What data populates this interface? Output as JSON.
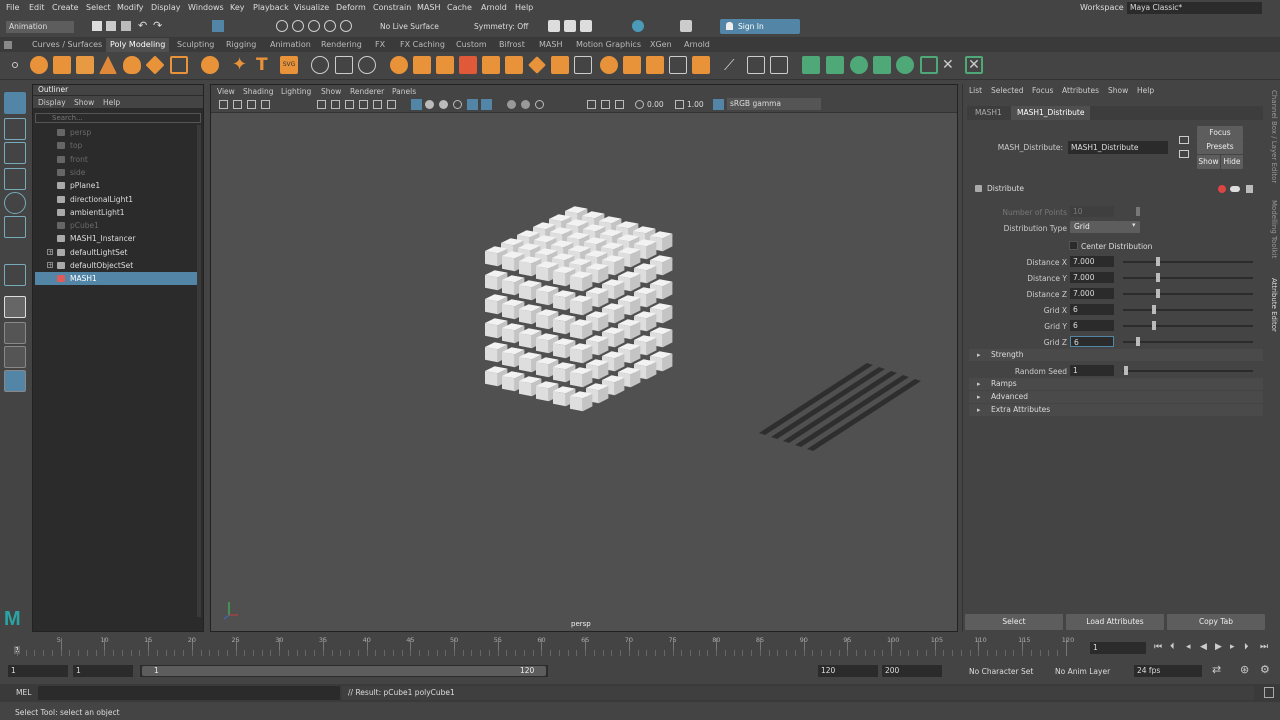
{
  "menubar": {
    "items": [
      "File",
      "Edit",
      "Create",
      "Select",
      "Modify",
      "Display",
      "Windows",
      "Key",
      "Playback",
      "Visualize",
      "Deform",
      "Constrain",
      "MASH",
      "Cache",
      "Arnold",
      "Help"
    ],
    "workspace_label": "Workspace :",
    "workspace_value": "Maya Classic*"
  },
  "status": {
    "mode": "Animation",
    "live_surface": "No Live Surface",
    "symmetry": "Symmetry: Off",
    "sign_in": "Sign In"
  },
  "shelf_tabs": [
    "Curves / Surfaces",
    "Poly Modeling",
    "Sculpting",
    "Rigging",
    "Animation",
    "Rendering",
    "FX",
    "FX Caching",
    "Custom",
    "Bifrost",
    "MASH",
    "Motion Graphics",
    "XGen",
    "Arnold"
  ],
  "shelf_active": "Poly Modeling",
  "outliner": {
    "title": "Outliner",
    "menu": [
      "Display",
      "Show",
      "Help"
    ],
    "search_placeholder": "Search...",
    "items": [
      {
        "label": "persp",
        "dim": true
      },
      {
        "label": "top",
        "dim": true
      },
      {
        "label": "front",
        "dim": true
      },
      {
        "label": "side",
        "dim": true
      },
      {
        "label": "pPlane1",
        "dim": false
      },
      {
        "label": "directionalLight1",
        "dim": false
      },
      {
        "label": "ambientLight1",
        "dim": false
      },
      {
        "label": "pCube1",
        "dim": true
      },
      {
        "label": "MASH1_Instancer",
        "dim": false
      },
      {
        "label": "defaultLightSet",
        "dim": false
      },
      {
        "label": "defaultObjectSet",
        "dim": false
      },
      {
        "label": "MASH1",
        "dim": false,
        "selected": true
      }
    ]
  },
  "viewport": {
    "menu": [
      "View",
      "Shading",
      "Lighting",
      "Show",
      "Renderer",
      "Panels"
    ],
    "exposure": "0.00",
    "gamma": "1.00",
    "color_space": "sRGB gamma",
    "camera_label": "persp"
  },
  "attribute_editor": {
    "menu": [
      "List",
      "Selected",
      "Focus",
      "Attributes",
      "Show",
      "Help"
    ],
    "tabs": [
      "MASH1",
      "MASH1_Distribute"
    ],
    "node_label": "MASH_Distribute:",
    "node_value": "MASH1_Distribute",
    "focus_btn": "Focus",
    "presets_btn": "Presets",
    "show_btn": "Show",
    "hide_btn": "Hide",
    "section_distribute": "Distribute",
    "number_of_points_label": "Number of Points",
    "number_of_points_value": "10",
    "distribution_type_label": "Distribution Type",
    "distribution_type_value": "Grid",
    "center_distribution_label": "Center Distribution",
    "fields": [
      {
        "label": "Distance X",
        "value": "7.000",
        "slider": 0.25
      },
      {
        "label": "Distance Y",
        "value": "7.000",
        "slider": 0.25
      },
      {
        "label": "Distance Z",
        "value": "7.000",
        "slider": 0.25
      },
      {
        "label": "Grid X",
        "value": "6",
        "slider": 0.22
      },
      {
        "label": "Grid Y",
        "value": "6",
        "slider": 0.22
      },
      {
        "label": "Grid Z",
        "value": "6",
        "slider": 0.1
      }
    ],
    "section_strength": "Strength",
    "random_seed_label": "Random Seed",
    "random_seed_value": "1",
    "sections_collapsed": [
      "Ramps",
      "Advanced",
      "Extra Attributes"
    ],
    "bottom_buttons": [
      "Select",
      "Load Attributes",
      "Copy Tab"
    ]
  },
  "side_tabs": [
    "Channel Box / Layer Editor",
    "Modelling Toolkit",
    "Attribute Editor"
  ],
  "timeline": {
    "ticks": [
      "5",
      "10",
      "15",
      "20",
      "25",
      "30",
      "35",
      "40",
      "45",
      "50",
      "55",
      "60",
      "65",
      "70",
      "75",
      "80",
      "85",
      "90",
      "95",
      "100",
      "105",
      "110",
      "115",
      "120"
    ],
    "start_tick": "1",
    "current_frame": "1"
  },
  "range": {
    "start": "1",
    "playback_start": "1",
    "range_start_label": "1",
    "range_end_label": "120",
    "playback_end": "120",
    "end": "200",
    "character_set": "No Character Set",
    "anim_layer": "No Anim Layer",
    "fps": "24 fps"
  },
  "command": {
    "lang": "MEL",
    "result": "// Result: pCube1 polyCube1"
  },
  "helpline": "Select Tool: select an object"
}
